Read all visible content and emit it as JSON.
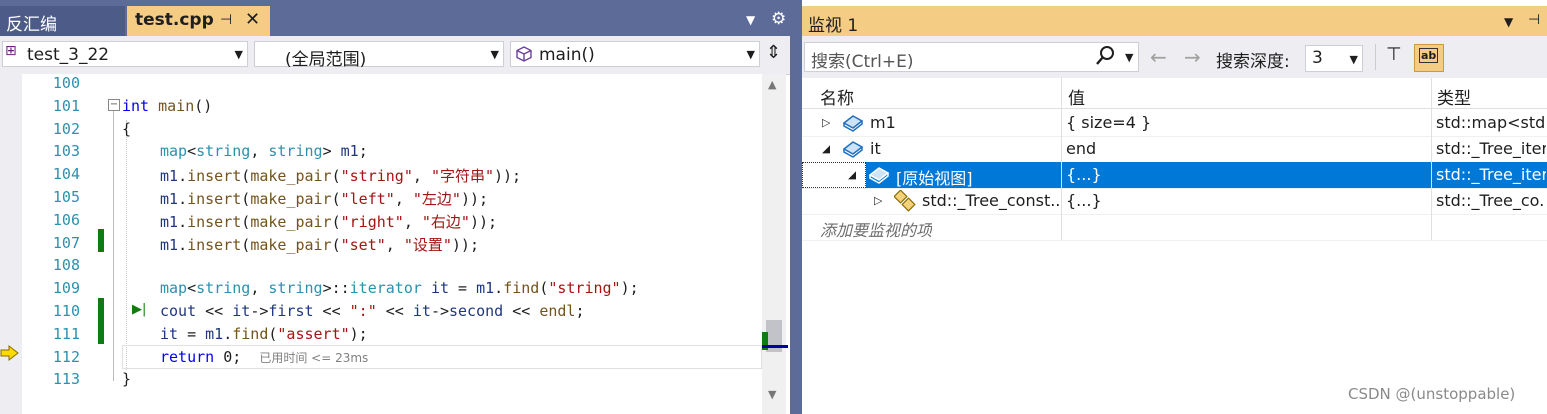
{
  "editor": {
    "tabs": [
      {
        "label": "反汇编"
      },
      {
        "label": "test.cpp",
        "pin": "⊣",
        "close": "✕"
      }
    ],
    "nav": {
      "project": "test_3_22",
      "scope": "(全局范围)",
      "function": "main()"
    },
    "lines": [
      {
        "n": "100"
      },
      {
        "n": "101"
      },
      {
        "n": "102"
      },
      {
        "n": "103"
      },
      {
        "n": "104"
      },
      {
        "n": "105"
      },
      {
        "n": "106"
      },
      {
        "n": "107"
      },
      {
        "n": "108"
      },
      {
        "n": "109"
      },
      {
        "n": "110"
      },
      {
        "n": "111"
      },
      {
        "n": "112"
      },
      {
        "n": "113"
      }
    ],
    "perf_tip": "已用时间 <= 23ms"
  },
  "watch": {
    "title": "监视 1",
    "search_placeholder": "搜索(Ctrl+E)",
    "depth_label": "搜索深度:",
    "depth_value": "3",
    "columns": {
      "name": "名称",
      "value": "值",
      "type": "类型"
    },
    "rows": [
      {
        "name": "m1",
        "value": "{ size=4 }",
        "type": "std::map<std."
      },
      {
        "name": "it",
        "value": "end",
        "type": "std::_Tree_iter..."
      },
      {
        "name": "[原始视图]",
        "value": "{...}",
        "type": "std::_Tree_iter..."
      },
      {
        "name": "std::_Tree_const...",
        "value": "{...}",
        "type": "std::_Tree_co..."
      }
    ],
    "add_hint": "添加要监视的项"
  },
  "watermark": "CSDN @(unstoppable)",
  "icons": [
    "pin-icon",
    "close-icon",
    "gear-icon",
    "dropdown-icon",
    "split-icon",
    "class-icon",
    "cube-icon",
    "search-icon",
    "back-arrow-icon",
    "forward-arrow-icon",
    "filter-pin-icon",
    "hex-icon",
    "next-statement-icon",
    "collapse-icon"
  ]
}
